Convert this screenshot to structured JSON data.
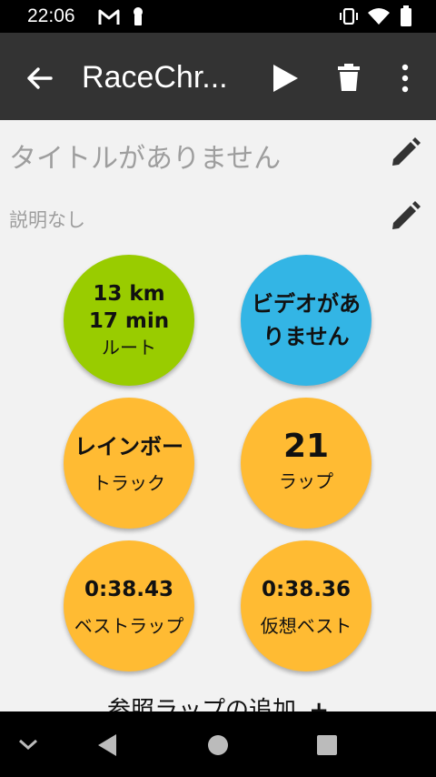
{
  "status_bar": {
    "time": "22:06",
    "icons": [
      "gmail-icon",
      "key-icon",
      "vibrate-icon",
      "wifi-icon",
      "battery-icon"
    ]
  },
  "app_bar": {
    "title": "RaceChr...",
    "icons": [
      "back-arrow-icon",
      "play-icon",
      "trash-icon",
      "more-vert-icon"
    ]
  },
  "header": {
    "title": "タイトルがありません",
    "description": "説明なし"
  },
  "tiles": {
    "route": {
      "line1": "13 km",
      "line2": "17 min",
      "label": "ルート",
      "color": "#99cc00"
    },
    "video": {
      "text": "ビデオがありません",
      "line1": "ビデオがあ",
      "line2": "りません",
      "color": "#33b5e5"
    },
    "rainbow": {
      "line1": "レインボー",
      "line2": "トラック",
      "color": "#ffbb33"
    },
    "laps": {
      "value": "21",
      "label": "ラップ",
      "color": "#ffbb33"
    },
    "best_lap": {
      "value": "0:38.43",
      "label": "ベストラップ",
      "color": "#ffbb33"
    },
    "virtual_best": {
      "value": "0:38.36",
      "label": "仮想ベスト",
      "color": "#ffbb33"
    }
  },
  "add_reference_lap": {
    "label": "参照ラップの追加"
  },
  "colors": {
    "app_bar": "#333333",
    "background": "#f2f2f2",
    "status_bar": "#000000",
    "nav_bar": "#000000"
  },
  "nav_bar": {
    "icons": [
      "chevron-down-icon",
      "back-triangle-icon",
      "home-circle-icon",
      "recents-square-icon"
    ]
  }
}
